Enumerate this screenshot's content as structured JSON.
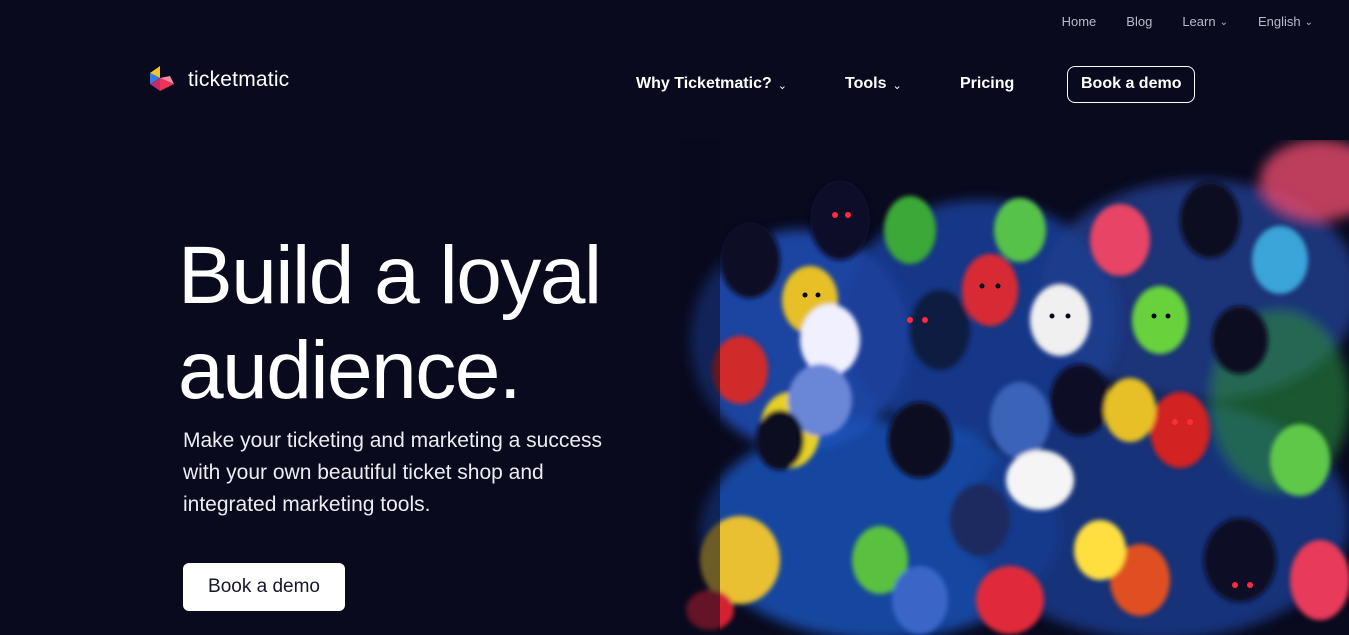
{
  "top_nav": {
    "home": "Home",
    "blog": "Blog",
    "learn": "Learn",
    "language": "English"
  },
  "logo": {
    "text": "ticketmatic",
    "icon": "ticketmatic-logo-mark"
  },
  "main_nav": {
    "why": "Why Ticketmatic?",
    "tools": "Tools",
    "pricing": "Pricing",
    "book_demo": "Book a demo"
  },
  "hero": {
    "title_line1": "Build a loyal",
    "title_line2": "audience.",
    "subtitle": "Make your ticketing and marketing a success with your own beautiful ticket shop and integrated marketing tools.",
    "cta": "Book a demo"
  },
  "illustration": {
    "icon": "crowd-illustration"
  },
  "colors": {
    "background": "#0a0a1e",
    "text": "#ffffff",
    "muted_text": "#b9bac8",
    "cta_bg": "#ffffff",
    "cta_text": "#16162c",
    "logo_yellow": "#f6c228",
    "logo_red": "#ee3355",
    "logo_blue": "#2f7ee8",
    "logo_pink": "#f08aa6"
  }
}
